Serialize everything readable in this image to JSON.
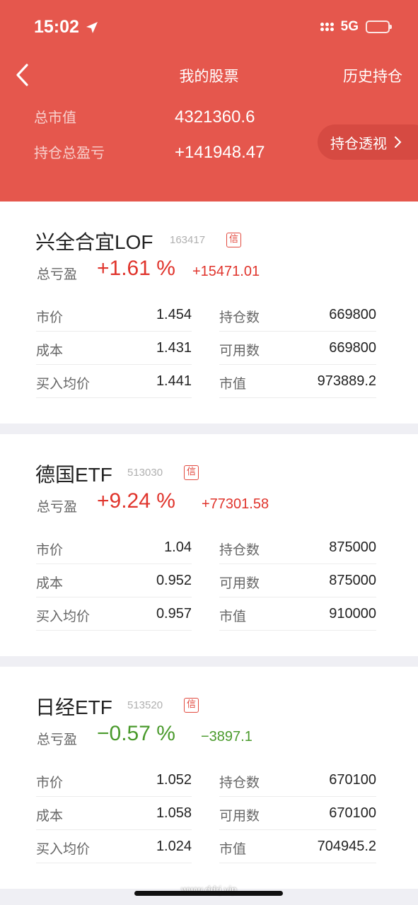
{
  "status_bar": {
    "time": "15:02",
    "network": "5G"
  },
  "nav": {
    "title": "我的股票",
    "right_link": "历史持仓"
  },
  "summary": {
    "total_value_label": "总市值",
    "total_value": "4321360.6",
    "total_pl_label": "持仓总盈亏",
    "total_pl": "+141948.47",
    "insight_button": "持仓透视"
  },
  "holdings": [
    {
      "name": "兴全合宜LOF",
      "code": "163417",
      "badge": "信",
      "pl_label": "总亏盈",
      "pl_pct": "+1.61 %",
      "pl_amount": "+15471.01",
      "trend": "up",
      "rows": [
        {
          "k1": "市价",
          "v1": "1.454",
          "k2": "持仓数",
          "v2": "669800"
        },
        {
          "k1": "成本",
          "v1": "1.431",
          "k2": "可用数",
          "v2": "669800"
        },
        {
          "k1": "买入均价",
          "v1": "1.441",
          "k2": "市值",
          "v2": "973889.2"
        }
      ]
    },
    {
      "name": "德国ETF",
      "code": "513030",
      "badge": "信",
      "pl_label": "总亏盈",
      "pl_pct": "+9.24 %",
      "pl_amount": "+77301.58",
      "trend": "up",
      "rows": [
        {
          "k1": "市价",
          "v1": "1.04",
          "k2": "持仓数",
          "v2": "875000"
        },
        {
          "k1": "成本",
          "v1": "0.952",
          "k2": "可用数",
          "v2": "875000"
        },
        {
          "k1": "买入均价",
          "v1": "0.957",
          "k2": "市值",
          "v2": "910000"
        }
      ]
    },
    {
      "name": "日经ETF",
      "code": "513520",
      "badge": "信",
      "pl_label": "总亏盈",
      "pl_pct": "−0.57 %",
      "pl_amount": "−3897.1",
      "trend": "down",
      "rows": [
        {
          "k1": "市价",
          "v1": "1.052",
          "k2": "持仓数",
          "v2": "670100"
        },
        {
          "k1": "成本",
          "v1": "1.058",
          "k2": "可用数",
          "v2": "670100"
        },
        {
          "k1": "买入均价",
          "v1": "1.024",
          "k2": "市值",
          "v2": "704945.2"
        }
      ]
    }
  ],
  "watermark": "www.ddrj.vip",
  "colors": {
    "header_bg": "#e5574d",
    "gain": "#e0342c",
    "loss": "#4a9a2c"
  }
}
